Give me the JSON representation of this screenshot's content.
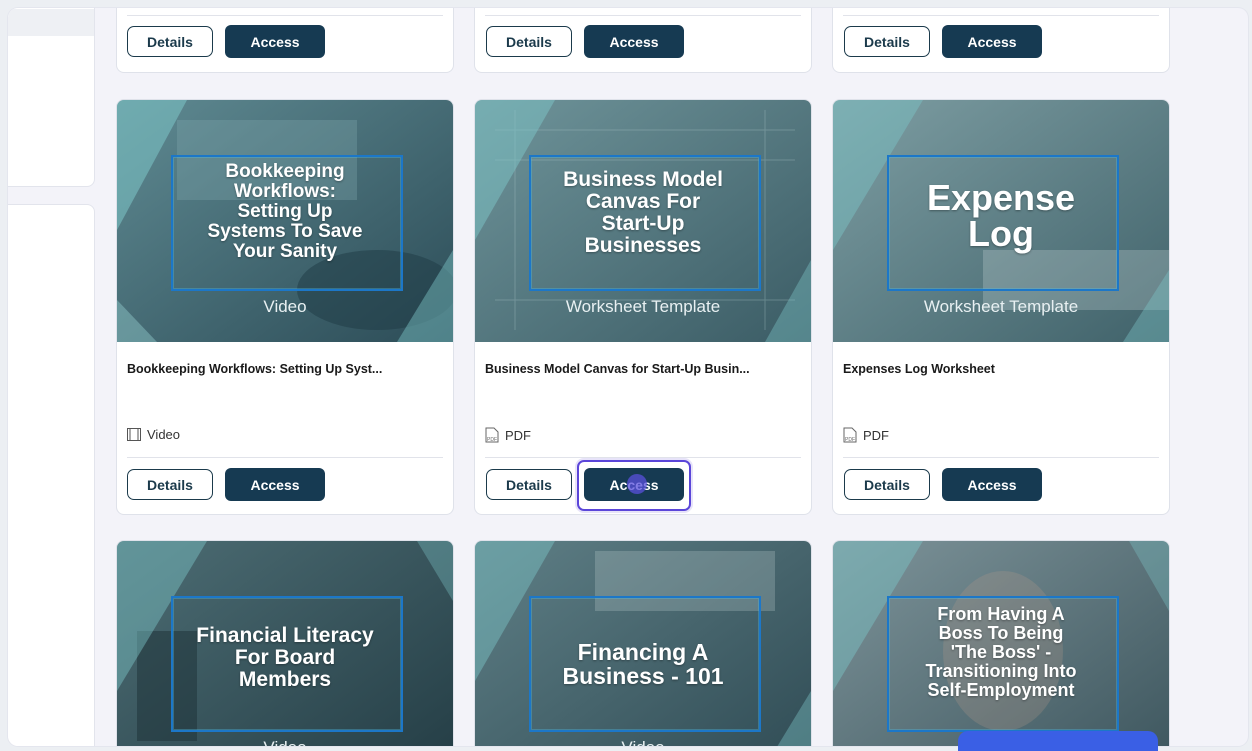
{
  "side": {
    "rows": [
      "..",
      ".."
    ]
  },
  "buttons": {
    "details": "Details",
    "access": "Access"
  },
  "top_row": [
    {
      "id": "t1"
    },
    {
      "id": "t2"
    },
    {
      "id": "t3"
    }
  ],
  "cards": [
    {
      "thumb_title": [
        "Bookkeeping",
        "Workflows:",
        "Setting Up",
        "Systems To Save",
        "Your Sanity"
      ],
      "thumb_type": "Video",
      "title": "Bookkeeping Workflows: Setting Up Syst...",
      "type": "Video",
      "type_icon": "film-icon"
    },
    {
      "thumb_title": [
        "Business Model",
        "Canvas For",
        "Start-Up",
        "Businesses"
      ],
      "thumb_type": "Worksheet Template",
      "title": "Business Model Canvas for Start-Up Busin...",
      "type": "PDF",
      "type_icon": "pdf-icon"
    },
    {
      "thumb_title": [
        "Expense",
        "Log"
      ],
      "thumb_type": "Worksheet Template",
      "title": "Expenses Log Worksheet",
      "type": "PDF",
      "type_icon": "pdf-icon"
    }
  ],
  "bottom_cards": [
    {
      "thumb_title": [
        "Financial Literacy",
        "For Board",
        "Members"
      ],
      "thumb_type": "Video"
    },
    {
      "thumb_title": [
        "Financing A",
        "Business - 101"
      ],
      "thumb_type": "Video"
    },
    {
      "thumb_title": [
        "From Having A",
        "Boss To Being",
        "'The Boss' -",
        "Transitioning Into",
        "Self-Employment"
      ],
      "thumb_type": ""
    }
  ],
  "colors": {
    "accent": "#163a52",
    "focus": "#5b46d9",
    "frame_blue": "#1c77c8",
    "thumb_teal": "#3d7f86"
  }
}
